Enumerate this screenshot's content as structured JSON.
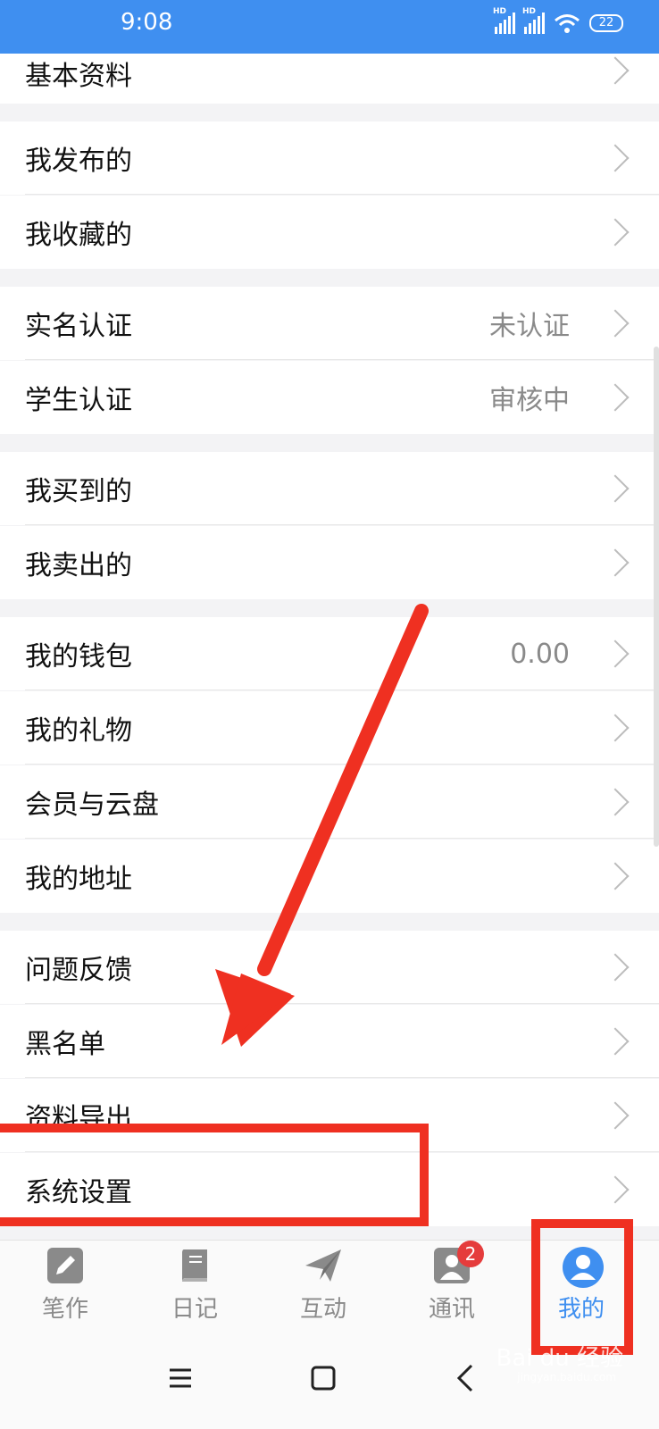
{
  "status_bar": {
    "time": "9:08",
    "battery": "22"
  },
  "menu": {
    "basic_info": "基本资料",
    "my_published": "我发布的",
    "my_favorites": "我收藏的",
    "real_name_auth": "实名认证",
    "real_name_auth_value": "未认证",
    "student_auth": "学生认证",
    "student_auth_value": "审核中",
    "my_purchased": "我买到的",
    "my_sold": "我卖出的",
    "my_wallet": "我的钱包",
    "my_wallet_value": "0.00",
    "my_gifts": "我的礼物",
    "membership_cloud": "会员与云盘",
    "my_address": "我的地址",
    "feedback": "问题反馈",
    "blacklist": "黑名单",
    "data_export": "资料导出",
    "system_settings": "系统设置"
  },
  "tabbar": {
    "tabs": [
      {
        "label": "笔作",
        "icon": "pencil-icon"
      },
      {
        "label": "日记",
        "icon": "book-icon"
      },
      {
        "label": "互动",
        "icon": "paper-plane-icon"
      },
      {
        "label": "通讯",
        "icon": "contacts-icon",
        "badge": "2"
      },
      {
        "label": "我的",
        "icon": "user-icon",
        "active": true
      }
    ]
  },
  "watermark": {
    "text": "Bai du 经验",
    "sub": "jingyan.baidu.com"
  },
  "colors": {
    "accent": "#3f8ff0",
    "annotation": "#ef3021",
    "badge": "#e53c3c"
  }
}
